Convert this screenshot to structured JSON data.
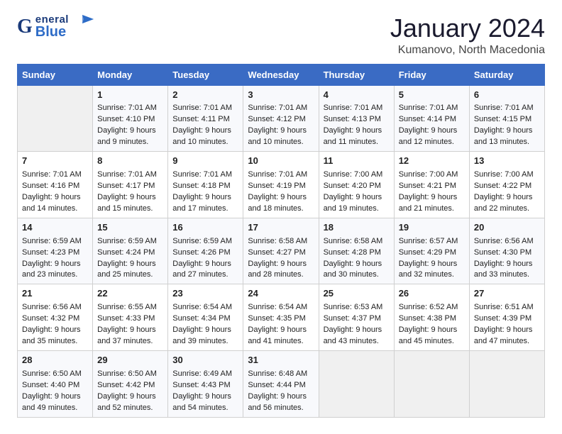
{
  "header": {
    "logo_g": "G",
    "logo_eneral": "eneral",
    "logo_blue": "Blue",
    "month": "January 2024",
    "location": "Kumanovo, North Macedonia"
  },
  "days_of_week": [
    "Sunday",
    "Monday",
    "Tuesday",
    "Wednesday",
    "Thursday",
    "Friday",
    "Saturday"
  ],
  "weeks": [
    [
      {
        "day": "",
        "lines": []
      },
      {
        "day": "1",
        "lines": [
          "Sunrise: 7:01 AM",
          "Sunset: 4:10 PM",
          "Daylight: 9 hours",
          "and 9 minutes."
        ]
      },
      {
        "day": "2",
        "lines": [
          "Sunrise: 7:01 AM",
          "Sunset: 4:11 PM",
          "Daylight: 9 hours",
          "and 10 minutes."
        ]
      },
      {
        "day": "3",
        "lines": [
          "Sunrise: 7:01 AM",
          "Sunset: 4:12 PM",
          "Daylight: 9 hours",
          "and 10 minutes."
        ]
      },
      {
        "day": "4",
        "lines": [
          "Sunrise: 7:01 AM",
          "Sunset: 4:13 PM",
          "Daylight: 9 hours",
          "and 11 minutes."
        ]
      },
      {
        "day": "5",
        "lines": [
          "Sunrise: 7:01 AM",
          "Sunset: 4:14 PM",
          "Daylight: 9 hours",
          "and 12 minutes."
        ]
      },
      {
        "day": "6",
        "lines": [
          "Sunrise: 7:01 AM",
          "Sunset: 4:15 PM",
          "Daylight: 9 hours",
          "and 13 minutes."
        ]
      }
    ],
    [
      {
        "day": "7",
        "lines": [
          "Sunrise: 7:01 AM",
          "Sunset: 4:16 PM",
          "Daylight: 9 hours",
          "and 14 minutes."
        ]
      },
      {
        "day": "8",
        "lines": [
          "Sunrise: 7:01 AM",
          "Sunset: 4:17 PM",
          "Daylight: 9 hours",
          "and 15 minutes."
        ]
      },
      {
        "day": "9",
        "lines": [
          "Sunrise: 7:01 AM",
          "Sunset: 4:18 PM",
          "Daylight: 9 hours",
          "and 17 minutes."
        ]
      },
      {
        "day": "10",
        "lines": [
          "Sunrise: 7:01 AM",
          "Sunset: 4:19 PM",
          "Daylight: 9 hours",
          "and 18 minutes."
        ]
      },
      {
        "day": "11",
        "lines": [
          "Sunrise: 7:00 AM",
          "Sunset: 4:20 PM",
          "Daylight: 9 hours",
          "and 19 minutes."
        ]
      },
      {
        "day": "12",
        "lines": [
          "Sunrise: 7:00 AM",
          "Sunset: 4:21 PM",
          "Daylight: 9 hours",
          "and 21 minutes."
        ]
      },
      {
        "day": "13",
        "lines": [
          "Sunrise: 7:00 AM",
          "Sunset: 4:22 PM",
          "Daylight: 9 hours",
          "and 22 minutes."
        ]
      }
    ],
    [
      {
        "day": "14",
        "lines": [
          "Sunrise: 6:59 AM",
          "Sunset: 4:23 PM",
          "Daylight: 9 hours",
          "and 23 minutes."
        ]
      },
      {
        "day": "15",
        "lines": [
          "Sunrise: 6:59 AM",
          "Sunset: 4:24 PM",
          "Daylight: 9 hours",
          "and 25 minutes."
        ]
      },
      {
        "day": "16",
        "lines": [
          "Sunrise: 6:59 AM",
          "Sunset: 4:26 PM",
          "Daylight: 9 hours",
          "and 27 minutes."
        ]
      },
      {
        "day": "17",
        "lines": [
          "Sunrise: 6:58 AM",
          "Sunset: 4:27 PM",
          "Daylight: 9 hours",
          "and 28 minutes."
        ]
      },
      {
        "day": "18",
        "lines": [
          "Sunrise: 6:58 AM",
          "Sunset: 4:28 PM",
          "Daylight: 9 hours",
          "and 30 minutes."
        ]
      },
      {
        "day": "19",
        "lines": [
          "Sunrise: 6:57 AM",
          "Sunset: 4:29 PM",
          "Daylight: 9 hours",
          "and 32 minutes."
        ]
      },
      {
        "day": "20",
        "lines": [
          "Sunrise: 6:56 AM",
          "Sunset: 4:30 PM",
          "Daylight: 9 hours",
          "and 33 minutes."
        ]
      }
    ],
    [
      {
        "day": "21",
        "lines": [
          "Sunrise: 6:56 AM",
          "Sunset: 4:32 PM",
          "Daylight: 9 hours",
          "and 35 minutes."
        ]
      },
      {
        "day": "22",
        "lines": [
          "Sunrise: 6:55 AM",
          "Sunset: 4:33 PM",
          "Daylight: 9 hours",
          "and 37 minutes."
        ]
      },
      {
        "day": "23",
        "lines": [
          "Sunrise: 6:54 AM",
          "Sunset: 4:34 PM",
          "Daylight: 9 hours",
          "and 39 minutes."
        ]
      },
      {
        "day": "24",
        "lines": [
          "Sunrise: 6:54 AM",
          "Sunset: 4:35 PM",
          "Daylight: 9 hours",
          "and 41 minutes."
        ]
      },
      {
        "day": "25",
        "lines": [
          "Sunrise: 6:53 AM",
          "Sunset: 4:37 PM",
          "Daylight: 9 hours",
          "and 43 minutes."
        ]
      },
      {
        "day": "26",
        "lines": [
          "Sunrise: 6:52 AM",
          "Sunset: 4:38 PM",
          "Daylight: 9 hours",
          "and 45 minutes."
        ]
      },
      {
        "day": "27",
        "lines": [
          "Sunrise: 6:51 AM",
          "Sunset: 4:39 PM",
          "Daylight: 9 hours",
          "and 47 minutes."
        ]
      }
    ],
    [
      {
        "day": "28",
        "lines": [
          "Sunrise: 6:50 AM",
          "Sunset: 4:40 PM",
          "Daylight: 9 hours",
          "and 49 minutes."
        ]
      },
      {
        "day": "29",
        "lines": [
          "Sunrise: 6:50 AM",
          "Sunset: 4:42 PM",
          "Daylight: 9 hours",
          "and 52 minutes."
        ]
      },
      {
        "day": "30",
        "lines": [
          "Sunrise: 6:49 AM",
          "Sunset: 4:43 PM",
          "Daylight: 9 hours",
          "and 54 minutes."
        ]
      },
      {
        "day": "31",
        "lines": [
          "Sunrise: 6:48 AM",
          "Sunset: 4:44 PM",
          "Daylight: 9 hours",
          "and 56 minutes."
        ]
      },
      {
        "day": "",
        "lines": []
      },
      {
        "day": "",
        "lines": []
      },
      {
        "day": "",
        "lines": []
      }
    ]
  ]
}
